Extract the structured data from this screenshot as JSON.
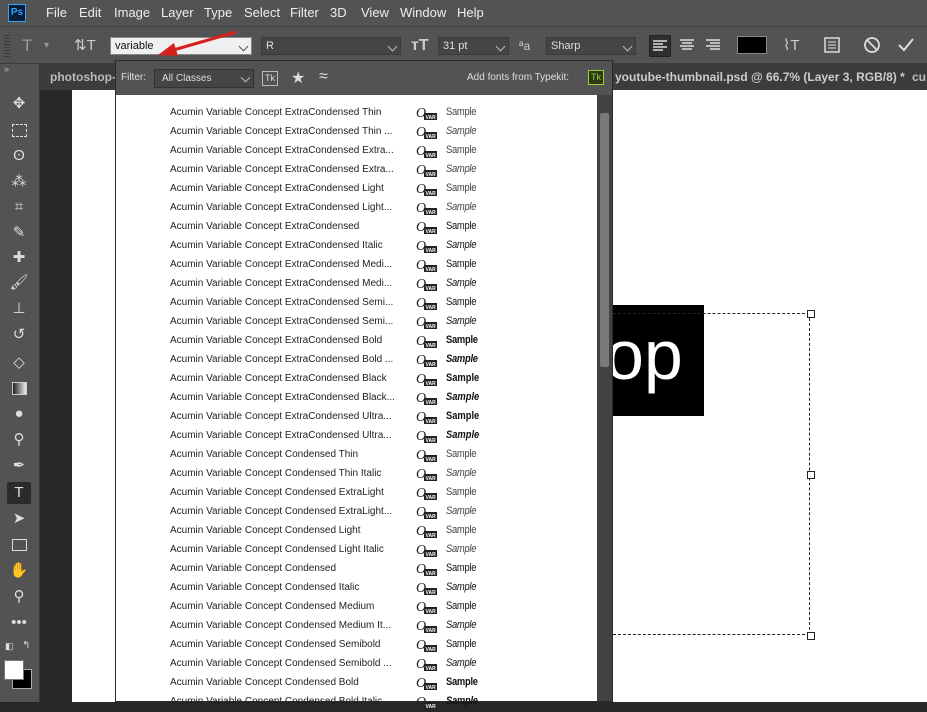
{
  "menubar": {
    "logo": "Ps",
    "items": [
      "File",
      "Edit",
      "Image",
      "Layer",
      "Type",
      "Select",
      "Filter",
      "3D",
      "View",
      "Window",
      "Help"
    ]
  },
  "options": {
    "font_family": "variable",
    "font_style": "R",
    "font_size": "31 pt",
    "antialias": "Sharp",
    "antialias_glyph": "ªa"
  },
  "tabs": [
    {
      "label": "photoshop-"
    },
    {
      "label": "youtube-thumbnail.psd @ 66.7% (Layer 3, RGB/8) *"
    },
    {
      "label": "cu"
    }
  ],
  "canvas": {
    "text": "op"
  },
  "font_panel": {
    "filter_label": "Filter:",
    "filter_value": "All Classes",
    "typekit_badge": "Tk",
    "add_fonts_label": "Add fonts from Typekit:",
    "sample_label": "Sample",
    "fonts": [
      {
        "name": "Acumin Variable Concept ExtraCondensed Thin",
        "w": 100,
        "i": false
      },
      {
        "name": "Acumin Variable Concept ExtraCondensed Thin ...",
        "w": 100,
        "i": true
      },
      {
        "name": "Acumin Variable Concept ExtraCondensed Extra...",
        "w": 200,
        "i": false
      },
      {
        "name": "Acumin Variable Concept ExtraCondensed Extra...",
        "w": 200,
        "i": true
      },
      {
        "name": "Acumin Variable Concept ExtraCondensed Light",
        "w": 300,
        "i": false
      },
      {
        "name": "Acumin Variable Concept ExtraCondensed Light...",
        "w": 300,
        "i": true
      },
      {
        "name": "Acumin Variable Concept ExtraCondensed",
        "w": 400,
        "i": false
      },
      {
        "name": "Acumin Variable Concept ExtraCondensed Italic",
        "w": 400,
        "i": true
      },
      {
        "name": "Acumin Variable Concept ExtraCondensed Medi...",
        "w": 500,
        "i": false
      },
      {
        "name": "Acumin Variable Concept ExtraCondensed Medi...",
        "w": 500,
        "i": true
      },
      {
        "name": "Acumin Variable Concept ExtraCondensed Semi...",
        "w": 600,
        "i": false
      },
      {
        "name": "Acumin Variable Concept ExtraCondensed Semi...",
        "w": 600,
        "i": true
      },
      {
        "name": "Acumin Variable Concept ExtraCondensed Bold",
        "w": 700,
        "i": false
      },
      {
        "name": "Acumin Variable Concept ExtraCondensed Bold ...",
        "w": 700,
        "i": true
      },
      {
        "name": "Acumin Variable Concept ExtraCondensed Black",
        "w": 800,
        "i": false
      },
      {
        "name": "Acumin Variable Concept ExtraCondensed Black...",
        "w": 800,
        "i": true
      },
      {
        "name": "Acumin Variable Concept ExtraCondensed Ultra...",
        "w": 900,
        "i": false
      },
      {
        "name": "Acumin Variable Concept ExtraCondensed Ultra...",
        "w": 900,
        "i": true
      },
      {
        "name": "Acumin Variable Concept Condensed Thin",
        "w": 100,
        "i": false
      },
      {
        "name": "Acumin Variable Concept Condensed Thin Italic",
        "w": 100,
        "i": true
      },
      {
        "name": "Acumin Variable Concept Condensed ExtraLight",
        "w": 200,
        "i": false
      },
      {
        "name": "Acumin Variable Concept Condensed ExtraLight...",
        "w": 200,
        "i": true
      },
      {
        "name": "Acumin Variable Concept Condensed Light",
        "w": 300,
        "i": false
      },
      {
        "name": "Acumin Variable Concept Condensed Light Italic",
        "w": 300,
        "i": true
      },
      {
        "name": "Acumin Variable Concept Condensed",
        "w": 400,
        "i": false
      },
      {
        "name": "Acumin Variable Concept Condensed Italic",
        "w": 400,
        "i": true
      },
      {
        "name": "Acumin Variable Concept Condensed Medium",
        "w": 500,
        "i": false
      },
      {
        "name": "Acumin Variable Concept Condensed Medium It...",
        "w": 500,
        "i": true
      },
      {
        "name": "Acumin Variable Concept Condensed Semibold",
        "w": 600,
        "i": false
      },
      {
        "name": "Acumin Variable Concept Condensed Semibold ...",
        "w": 600,
        "i": true
      },
      {
        "name": "Acumin Variable Concept Condensed Bold",
        "w": 700,
        "i": false
      },
      {
        "name": "Acumin Variable Concept Condensed Bold Italic",
        "w": 700,
        "i": true
      }
    ]
  },
  "tools": [
    "move-tool",
    "marquee-tool",
    "lasso-tool",
    "quick-select-tool",
    "crop-tool",
    "eyedropper-tool",
    "healing-tool",
    "brush-tool",
    "stamp-tool",
    "history-brush-tool",
    "eraser-tool",
    "gradient-tool",
    "blur-tool",
    "dodge-tool",
    "pen-tool",
    "type-tool",
    "path-select-tool",
    "rectangle-tool",
    "hand-tool",
    "zoom-tool",
    "more-tools"
  ]
}
